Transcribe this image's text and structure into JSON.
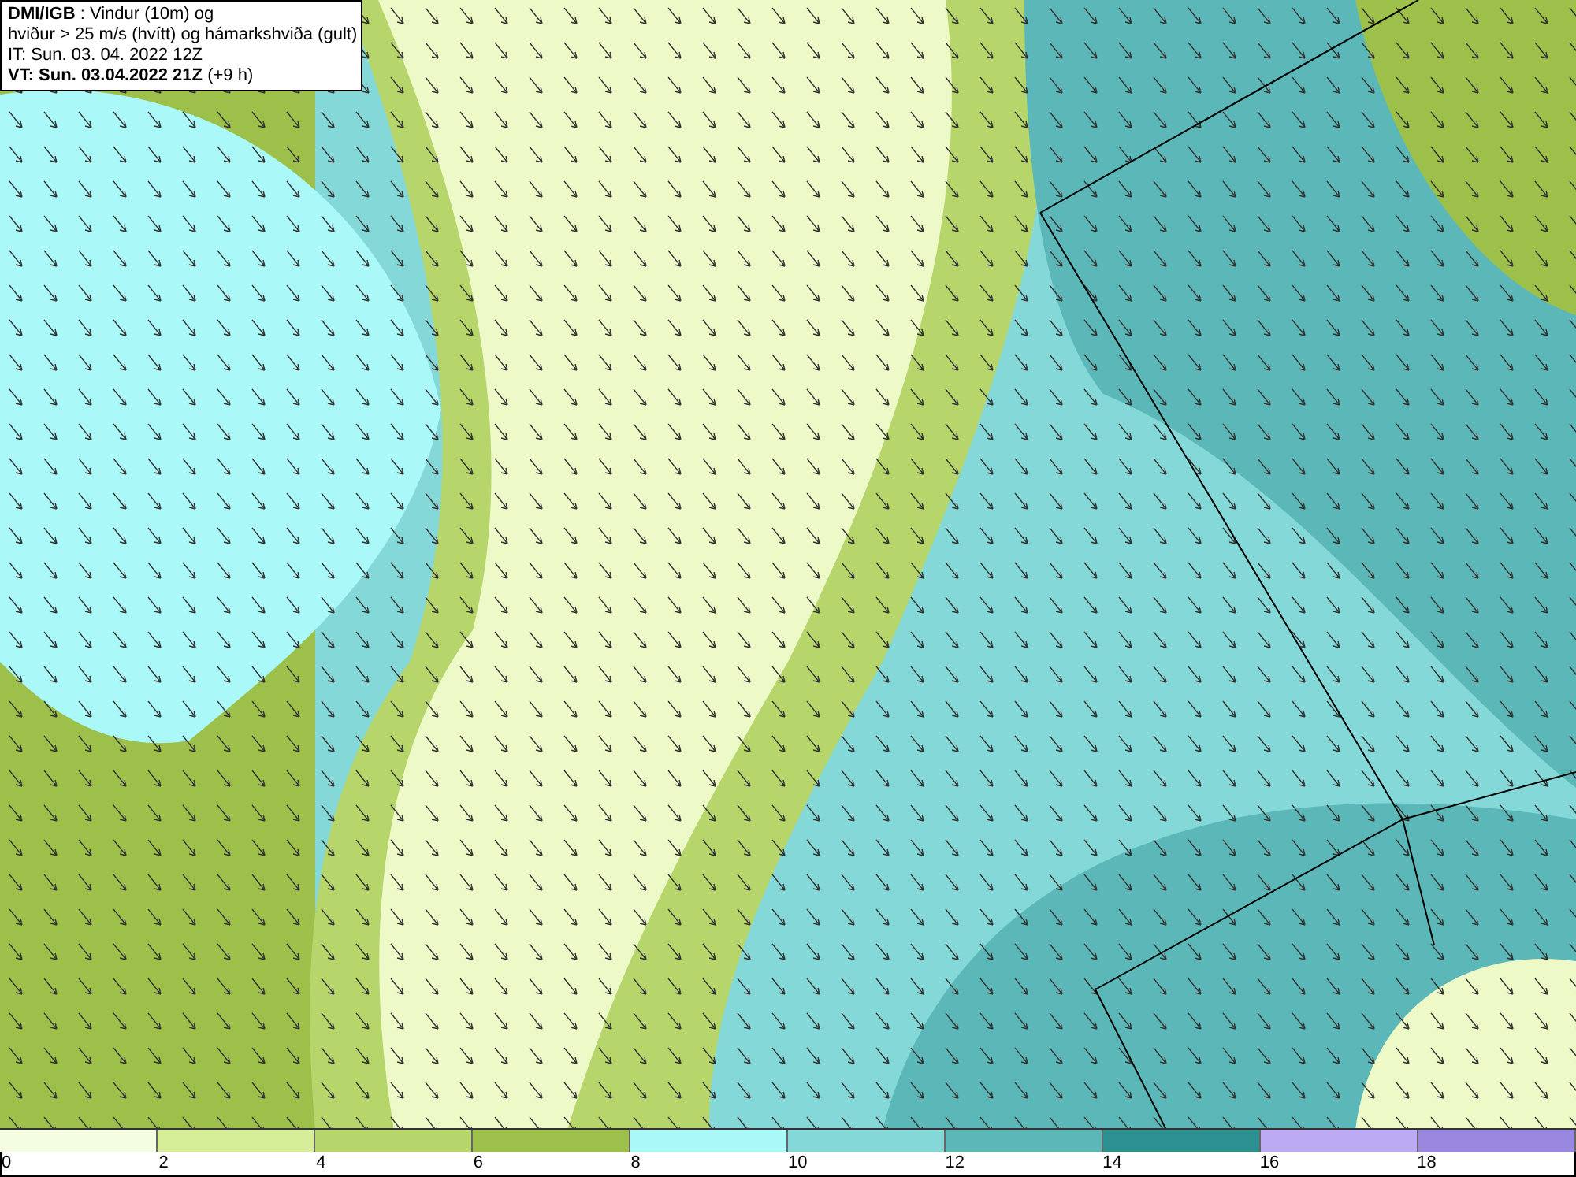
{
  "title_lines": [
    "**DMI/IGB** : Vindur (10m) og",
    "hviður > 25 m/s (hvítt) og hámarkshviða (gult)",
    "IT: Sun. 03. 04. 2022 12Z",
    "**VT: Sun. 03.04.2022 21Z** (+9 h)"
  ],
  "legend": [
    {
      "label": "0",
      "color": "#f4fde0"
    },
    {
      "label": "2",
      "color": "#d6ee98"
    },
    {
      "label": "4",
      "color": "#b6d66c"
    },
    {
      "label": "6",
      "color": "#9cc04a"
    },
    {
      "label": "8",
      "color": "#aaf8f8"
    },
    {
      "label": "10",
      "color": "#84d8d8"
    },
    {
      "label": "12",
      "color": "#5cb8b8"
    },
    {
      "label": "14",
      "color": "#2c9090"
    },
    {
      "label": "16",
      "color": "#bcaaf4"
    },
    {
      "label": "18",
      "color": "#9a88e0"
    }
  ]
}
